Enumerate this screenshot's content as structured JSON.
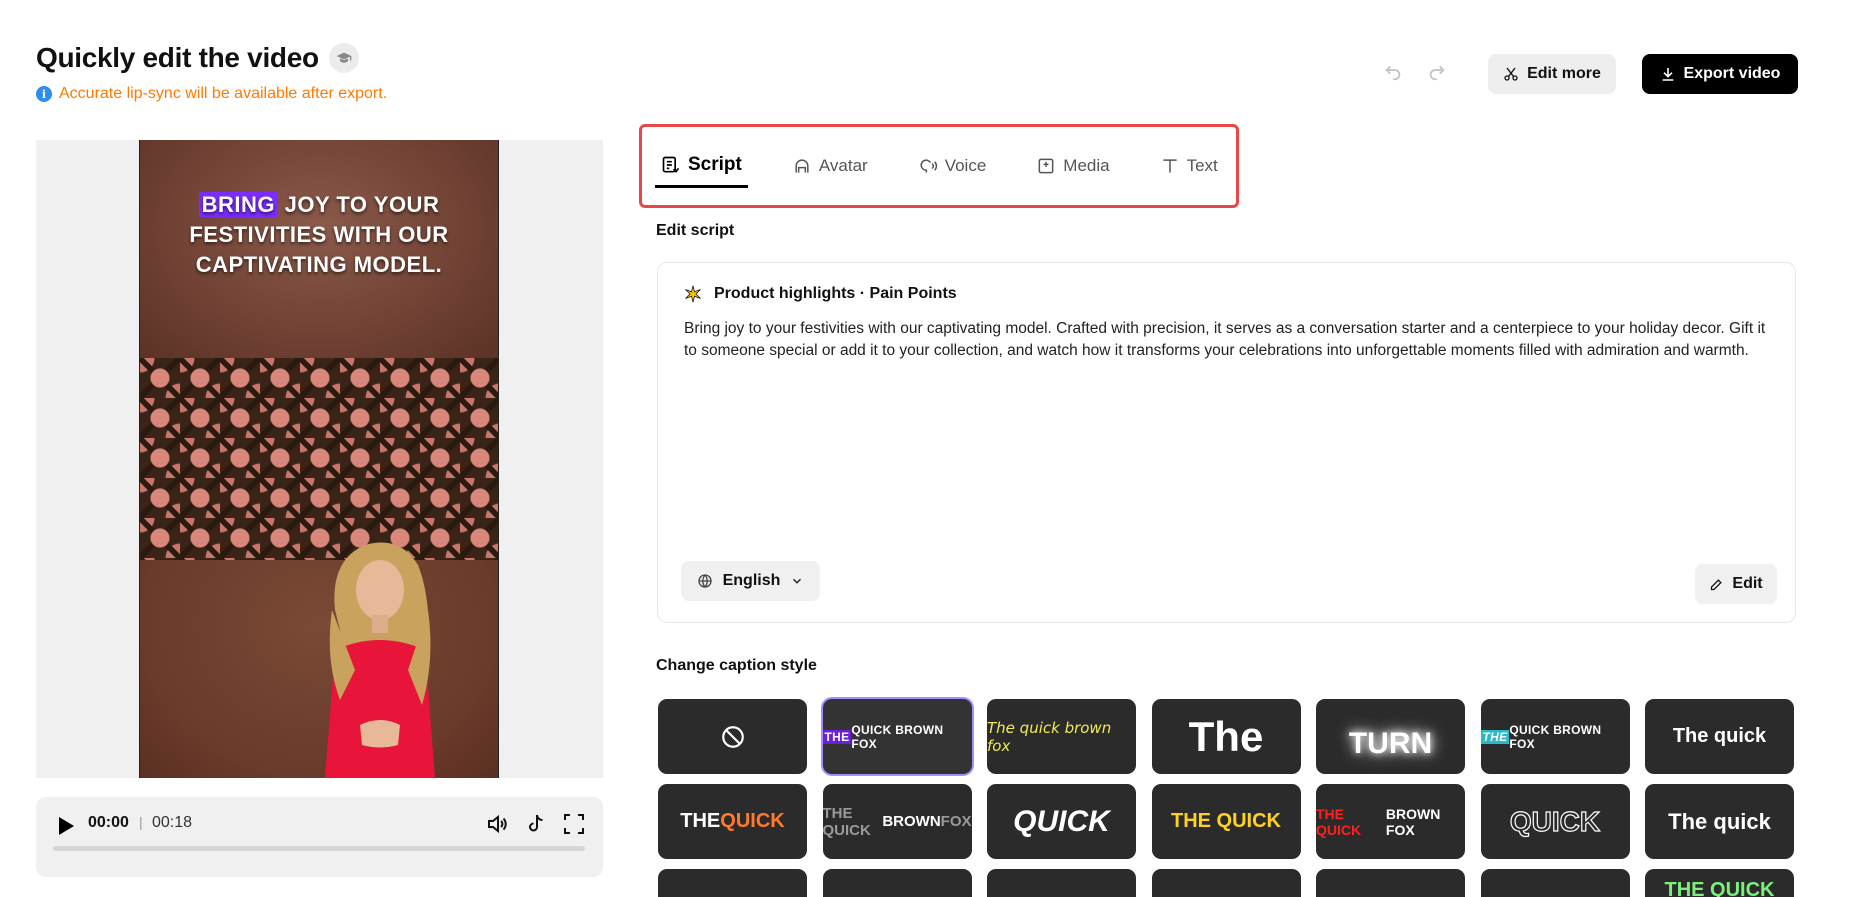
{
  "header": {
    "title": "Quickly edit the video",
    "notice": "Accurate lip-sync will be available after export.",
    "edit_more_label": "Edit more",
    "export_label": "Export video"
  },
  "preview": {
    "caption_highlight": "BRING",
    "caption_line1_rest": " JOY TO YOUR",
    "caption_line2": "FESTIVITIES WITH OUR",
    "caption_line3": "CAPTIVATING MODEL."
  },
  "player": {
    "current_time": "00:00",
    "separator": "|",
    "total_time": "00:18",
    "progress": 0
  },
  "tabs": [
    {
      "label": "Script",
      "icon": "script-icon",
      "active": true
    },
    {
      "label": "Avatar",
      "icon": "avatar-icon",
      "active": false
    },
    {
      "label": "Voice",
      "icon": "voice-icon",
      "active": false
    },
    {
      "label": "Media",
      "icon": "media-icon",
      "active": false
    },
    {
      "label": "Text",
      "icon": "text-icon",
      "active": false
    }
  ],
  "script": {
    "section_label": "Edit script",
    "card_title": "Product highlights · Pain Points",
    "body": "Bring joy to your festivities with our captivating model. Crafted with precision, it serves as a conversation starter and a centerpiece to your holiday decor. Gift it to someone special or add it to your collection, and watch how it transforms your celebrations into unforgettable moments filled with admiration and warmth.",
    "language": "English",
    "edit_label": "Edit"
  },
  "caption_styles": {
    "section_label": "Change caption style",
    "tiles": [
      {
        "kind": "none"
      },
      {
        "kind": "text",
        "text_a": "THE",
        "text_b": " QUICK BROWN FOX",
        "selected": true
      },
      {
        "kind": "text",
        "text_a": "The quick brown fox"
      },
      {
        "kind": "text",
        "text_a": "The"
      },
      {
        "kind": "text",
        "text_a": "TURN"
      },
      {
        "kind": "text",
        "text_a": "THE",
        "text_b": " QUICK BROWN FOX"
      },
      {
        "kind": "text",
        "text_a": "The quick"
      },
      {
        "kind": "text",
        "text_a": "THE ",
        "text_b": "QUICK"
      },
      {
        "kind": "text",
        "text_a": "THE QUICK ",
        "text_b": "BROWN",
        "text_c": " FOX"
      },
      {
        "kind": "text",
        "text_a": "QUICK"
      },
      {
        "kind": "text",
        "text_a": "THE QUICK"
      },
      {
        "kind": "text",
        "text_a": "THE QUICK",
        "text_b": " BROWN FOX"
      },
      {
        "kind": "text",
        "text_a": "QUICK"
      },
      {
        "kind": "text",
        "text_a": "The quick"
      },
      {
        "kind": "text",
        "text_a": "THE QUICK"
      }
    ]
  },
  "colors": {
    "accent_red": "#e8474a",
    "notice_orange": "#ff7a00",
    "highlight_purple": "#7b2cff",
    "selected_border": "#a58cff"
  }
}
